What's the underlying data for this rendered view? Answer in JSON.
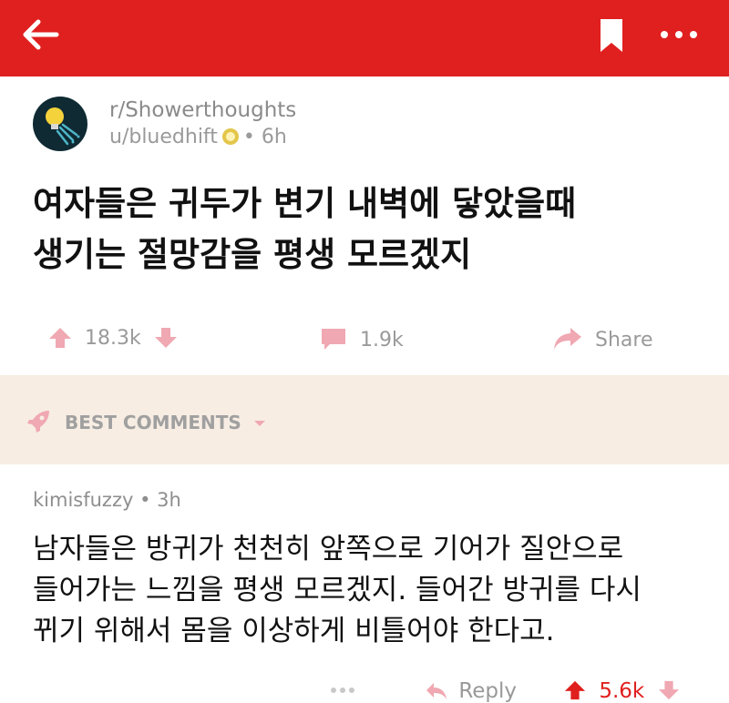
{
  "topbar": {
    "color": "#e0201f",
    "back_icon": "arrow-left-icon",
    "bookmark_icon": "bookmark-icon",
    "more_icon": "more-horizontal-icon"
  },
  "post": {
    "subreddit": "r/Showerthoughts",
    "username": "u/bluedhift",
    "age": "6h",
    "title_line1": "여자들은 귀두가 변기 내벽에 닿았을때",
    "title_line2": "생기는 절망감을 평생 모르겠지",
    "upvotes": "18.3k",
    "comments": "1.9k",
    "share_label": "Share"
  },
  "best_comments": {
    "label": "BEST COMMENTS",
    "icon": "rocket-icon"
  },
  "comment": {
    "author": "kimisfuzzy",
    "age": "3h",
    "line1": "남자들은 방귀가 천천히 앞쪽으로 기어가 질안으로",
    "line2": "들어가는 느낌을 평생 모르겠지. 들어간 방귀를 다시",
    "line3": "뀌기 위해서 몸을 이상하게 비틀어야 한다고.",
    "reply_label": "Reply",
    "score": "5.6k"
  },
  "colors": {
    "accent": "#e0201f",
    "icon_pink": "#f0a8b2",
    "band": "#f7ede3"
  }
}
